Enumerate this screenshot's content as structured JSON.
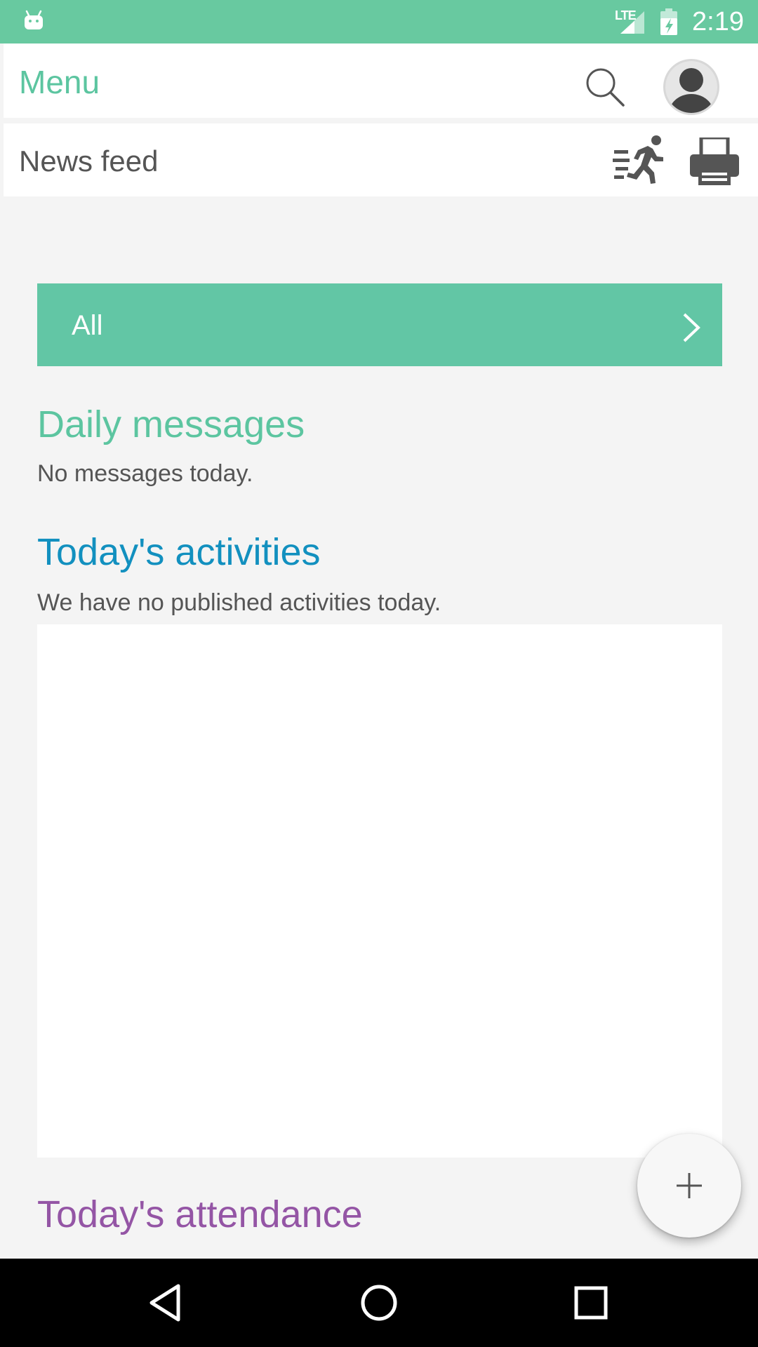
{
  "status_bar": {
    "time": "2:19",
    "network": "LTE",
    "icons": [
      "android-icon",
      "signal-icon",
      "battery-icon"
    ]
  },
  "header": {
    "menu_title": "Menu",
    "section_title": "News feed",
    "icons": [
      "search-icon",
      "avatar-icon",
      "runner-icon",
      "printer-icon"
    ]
  },
  "filter": {
    "label": "All",
    "icon": "chevron-right-icon"
  },
  "daily_messages": {
    "title": "Daily messages",
    "text": "No messages today."
  },
  "activities": {
    "title": "Today's activities",
    "text": "We have no published activities today."
  },
  "attendance": {
    "title": "Today's attendance"
  },
  "fab": {
    "icon": "plus-icon"
  },
  "navigation": {
    "icons": [
      "back-icon",
      "home-icon",
      "recents-icon"
    ]
  },
  "colors": {
    "status_bar": "#68c9a0",
    "accent_green": "#5cc5a0",
    "filter_bar": "#62c6a5",
    "activities_blue": "#1290bf",
    "attendance_purple": "#9455a5",
    "background": "#f4f4f4"
  }
}
